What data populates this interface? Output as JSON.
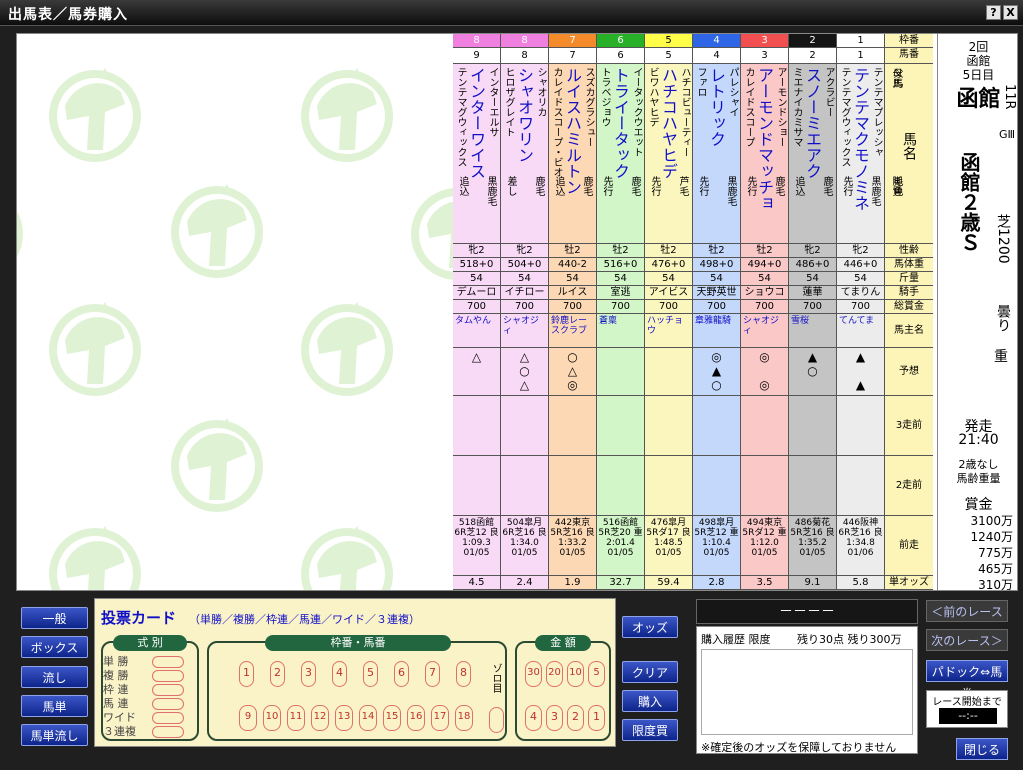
{
  "window": {
    "title": "出馬表／馬券購入",
    "help_label": "?",
    "close_label": "X"
  },
  "legend_rows": {
    "frame": "枠番",
    "num": "馬番",
    "names": [
      "父馬",
      "馬名",
      "毛色",
      "母馬",
      "脚質"
    ],
    "sex": "性齢",
    "weight": "馬体重",
    "kinryo": "斤量",
    "jockey": "騎手",
    "prize": "総賞金",
    "owner": "馬主名",
    "yoso": "予想",
    "prev3": "3走前",
    "prev2": "2走前",
    "prev1": "前走",
    "odds": "単オッズ"
  },
  "horses": [
    {
      "frame": "1",
      "num": "1",
      "sire": "テンテマグウィックス",
      "name": "テンテマクモノミネ",
      "dam": "テンテマプレッシャ",
      "color": "黒鹿毛",
      "style": "先行",
      "sex": "牝2",
      "weight": "446+0",
      "kinryo": "54",
      "jockey": "てまりん",
      "prize": "700",
      "owner": "てんてま",
      "yoso": [
        "▲",
        "",
        "▲"
      ],
      "prev": "446阪神 6R芝16 良 1:34.8 01/06",
      "odds": "5.8",
      "bg": "#ececec",
      "hbg": "#ffffff",
      "hfg": "#000000"
    },
    {
      "frame": "2",
      "num": "2",
      "sire": "ミエナイカミサマ",
      "name": "スノーミエアク",
      "dam": "アクラビー",
      "color": "鹿毛",
      "style": "追込",
      "sex": "牝2",
      "weight": "486+0",
      "kinryo": "54",
      "jockey": "蓮華",
      "prize": "700",
      "owner": "雪桜",
      "yoso": [
        "▲",
        "○",
        ""
      ],
      "prev": "486菊花 5R芝16 良 1:35.2 01/05",
      "odds": "9.1",
      "bg": "#c4c4c4",
      "hbg": "#151515",
      "hfg": "#ffffff"
    },
    {
      "frame": "3",
      "num": "3",
      "sire": "カレイドスコープ",
      "name": "アーモンドマッチョ",
      "dam": "アーモンドショー",
      "color": "鹿毛",
      "style": "先行",
      "sex": "牡2",
      "weight": "494+0",
      "kinryo": "54",
      "jockey": "ショウコ",
      "prize": "700",
      "owner": "シャオジィ",
      "yoso": [
        "◎",
        "",
        "◎"
      ],
      "prev": "494東京 5Rダ12 重 1:12.0 01/05",
      "odds": "3.5",
      "bg": "#fbc8c8",
      "hbg": "#f25050",
      "hfg": "#ffffff"
    },
    {
      "frame": "4",
      "num": "4",
      "sire": "ファロ",
      "name": "レトリック",
      "dam": "パレシャイ",
      "color": "黒鹿毛",
      "style": "先行",
      "sex": "牡2",
      "weight": "498+0",
      "kinryo": "54",
      "jockey": "天野英世",
      "prize": "700",
      "owner": "章雅龍騎",
      "yoso": [
        "◎",
        "▲",
        "○"
      ],
      "prev": "498皐月 5R芝12 重 1:10.4 01/05",
      "odds": "2.8",
      "bg": "#c4d8fb",
      "hbg": "#2f66e6",
      "hfg": "#ffffff"
    },
    {
      "frame": "5",
      "num": "5",
      "sire": "ビワハヤヒデ",
      "name": "ハチコハヤヒデ",
      "dam": "ハチコビューティー",
      "color": "芦毛",
      "style": "先行",
      "sex": "牡2",
      "weight": "476+0",
      "kinryo": "54",
      "jockey": "アイビス",
      "prize": "700",
      "owner": "ハッチョウ",
      "yoso": [
        "",
        "",
        ""
      ],
      "prev": "476皐月 5Rダ17 良 1:48.5 01/05",
      "odds": "59.4",
      "bg": "#fbf6be",
      "hbg": "#ffff4a",
      "hfg": "#000000"
    },
    {
      "frame": "6",
      "num": "6",
      "sire": "トラベジョウ",
      "name": "トライータック",
      "dam": "イータックウエット",
      "color": "鹿毛",
      "style": "先行",
      "sex": "牡2",
      "weight": "516+0",
      "kinryo": "54",
      "jockey": "室逃",
      "prize": "700",
      "owner": "蒼稟",
      "yoso": [
        "",
        "",
        ""
      ],
      "prev": "516函館 5R芝20 重 2:01.4 01/05",
      "odds": "32.7",
      "bg": "#d2f6c8",
      "hbg": "#28b028",
      "hfg": "#ffffff"
    },
    {
      "frame": "7",
      "num": "7",
      "sire": "カレイドスコープ・ビオ",
      "name": "ルイスハミルトン",
      "dam": "スズカグラシュー",
      "color": "鹿毛",
      "style": "追込",
      "sex": "牡2",
      "weight": "440-2",
      "kinryo": "54",
      "jockey": "ルイス",
      "prize": "700",
      "owner": "鈴鹿レースクラブ",
      "yoso": [
        "○",
        "△",
        "◎"
      ],
      "prev": "442東京 5R芝16 良 1:33.2 01/05",
      "odds": "1.9",
      "bg": "#fdd8b4",
      "hbg": "#f58a2b",
      "hfg": "#ffffff"
    },
    {
      "frame": "8",
      "num": "8",
      "sire": "ヒロザグレイト",
      "name": "シャオワリン",
      "dam": "シャオリカ",
      "color": "鹿毛",
      "style": "差し",
      "sex": "牝2",
      "weight": "504+0",
      "kinryo": "54",
      "jockey": "イチロー",
      "prize": "700",
      "owner": "シャオジィ",
      "yoso": [
        "△",
        "○",
        "△"
      ],
      "prev": "504皐月 6R芝16 良 1:34.0 01/05",
      "odds": "2.4",
      "bg": "#f9daf6",
      "hbg": "#f080e0",
      "hfg": "#ffffff"
    },
    {
      "frame": "8",
      "num": "9",
      "sire": "テンテマグウィックス",
      "name": "インターワイス",
      "dam": "インターエルサ",
      "color": "黒鹿毛",
      "style": "追込",
      "sex": "牝2",
      "weight": "518+0",
      "kinryo": "54",
      "jockey": "デムーロ",
      "prize": "700",
      "owner": "タムやん",
      "yoso": [
        "△",
        "",
        ""
      ],
      "prev": "518函館 6R芝12 良 1:09.3 01/05",
      "odds": "4.5",
      "bg": "#f9daf6",
      "hbg": "#f080e0",
      "hfg": "#ffffff"
    }
  ],
  "race": {
    "kai": "2回",
    "venue": "函館",
    "day": "5日目",
    "rnum": "11R",
    "grade": "GⅢ",
    "name": "函館２歳Ｓ",
    "course": "芝1200",
    "weather": "曇り",
    "going": "重",
    "start_label": "発走",
    "start_time": "21:40",
    "cond1": "2歳なし",
    "cond2": "馬齢重量",
    "prize_label": "賞金",
    "prizes": [
      "3100万",
      "1240万",
      "775万",
      "465万",
      "310万"
    ]
  },
  "left_buttons": [
    "一般",
    "ボックス",
    "流し",
    "馬単",
    "馬単流し"
  ],
  "ticket": {
    "title": "投票カード",
    "subtitle": "（単勝／複勝／枠連／馬連／ワイド／３連複）",
    "shiki_title": "式 別",
    "bets": [
      "単 勝",
      "複 勝",
      "枠 連",
      "馬 連",
      "ワイド",
      "３連複"
    ],
    "umaban_title": "枠番・馬番",
    "row1": [
      "1",
      "2",
      "3",
      "4",
      "5",
      "6",
      "7",
      "8"
    ],
    "row2": [
      "9",
      "10",
      "11",
      "12",
      "13",
      "14",
      "15",
      "16",
      "17",
      "18"
    ],
    "zoro": "ゾロ目",
    "kingaku_title": "金 額",
    "amt1": [
      "30",
      "20",
      "10",
      "5"
    ],
    "amt2": [
      "4",
      "3",
      "2",
      "1"
    ]
  },
  "right_buttons": [
    "オッズ",
    "クリア",
    "購入",
    "限度買"
  ],
  "history": {
    "odds_display": "－－－－",
    "header": "購入履歴 限度",
    "remain": "残り30点 残り300万",
    "note": "※確定後のオッズを保障しておりません"
  },
  "nav": {
    "prev": "＜前のレース",
    "next": "次のレース＞",
    "paddock": "パドック⇔馬券",
    "until_label": "レース開始まで",
    "until_value": "--:--",
    "close": "閉じる"
  },
  "colors": {
    "accent": "#1010c8",
    "button": "#1c38b0",
    "panel": "#fbf3c8",
    "group": "#226640"
  }
}
